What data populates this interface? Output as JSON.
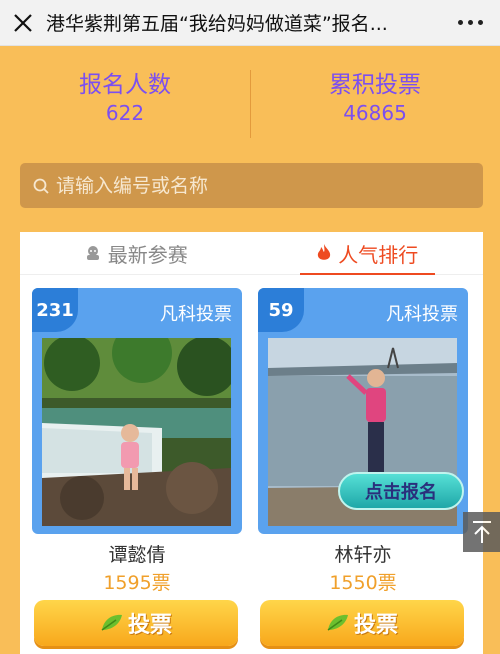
{
  "topbar": {
    "title": "港华紫荆第五届“我给妈妈做道菜”报名...",
    "close_icon": "close-icon",
    "more_icon": "more-icon"
  },
  "stats": [
    {
      "label": "报名人数",
      "value": "622"
    },
    {
      "label": "累积投票",
      "value": "46865"
    }
  ],
  "search": {
    "placeholder": "请输入编号或名称",
    "icon": "search-icon"
  },
  "tabs": [
    {
      "label": "最新参赛",
      "icon": "newest-icon",
      "active": false
    },
    {
      "label": "人气排行",
      "icon": "flame-icon",
      "active": true
    }
  ],
  "cards": [
    {
      "rank": "231",
      "brand": "凡科投票",
      "name": "谭懿倩",
      "votes": "1595票",
      "vote_label": "投票"
    },
    {
      "rank": "59",
      "brand": "凡科投票",
      "name": "林轩亦",
      "votes": "1550票",
      "vote_label": "投票",
      "overlay_button": "点击报名"
    }
  ],
  "colors": {
    "background": "#f9be58",
    "accent_purple": "#7c4ff0",
    "tab_active": "#ee4a20",
    "card_blue": "#5aa2ee",
    "vote_orange": "#f0a02b"
  },
  "back_to_top_icon": "back-to-top-icon"
}
